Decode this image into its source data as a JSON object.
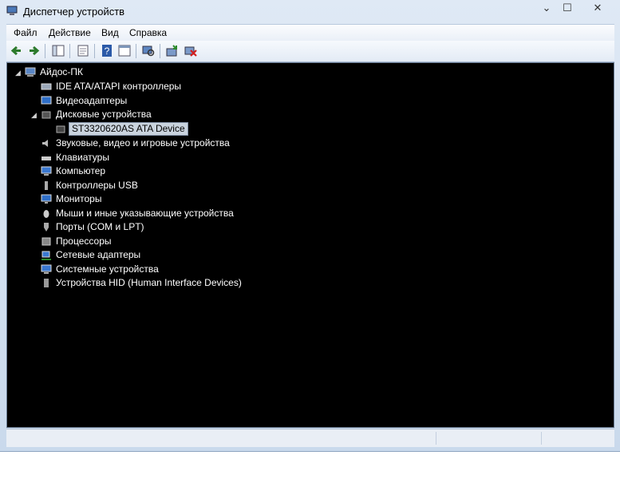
{
  "window": {
    "title": "Диспетчер устройств"
  },
  "menu": [
    "Файл",
    "Действие",
    "Вид",
    "Справка"
  ],
  "toolbar": [
    "back-icon",
    "forward-icon",
    "console-tree-icon",
    "properties-icon",
    "help-icon",
    "show-hidden-icon",
    "scan-hardware-icon",
    "update-driver-icon",
    "uninstall-device-icon"
  ],
  "tree": {
    "root": "Айдос-ПК",
    "categories": [
      {
        "label": "IDE ATA/ATAPI контроллеры"
      },
      {
        "label": "Видеоадаптеры"
      },
      {
        "label": "Дисковые устройства",
        "expanded": true,
        "children": [
          "ST3320620AS ATA Device"
        ]
      },
      {
        "label": "Звуковые, видео и игровые устройства"
      },
      {
        "label": "Клавиатуры"
      },
      {
        "label": "Компьютер"
      },
      {
        "label": "Контроллеры USB"
      },
      {
        "label": "Мониторы"
      },
      {
        "label": "Мыши и иные указывающие устройства"
      },
      {
        "label": "Порты (COM и LPT)"
      },
      {
        "label": "Процессоры"
      },
      {
        "label": "Сетевые адаптеры"
      },
      {
        "label": "Системные устройства"
      },
      {
        "label": "Устройства HID (Human Interface Devices)"
      }
    ]
  }
}
